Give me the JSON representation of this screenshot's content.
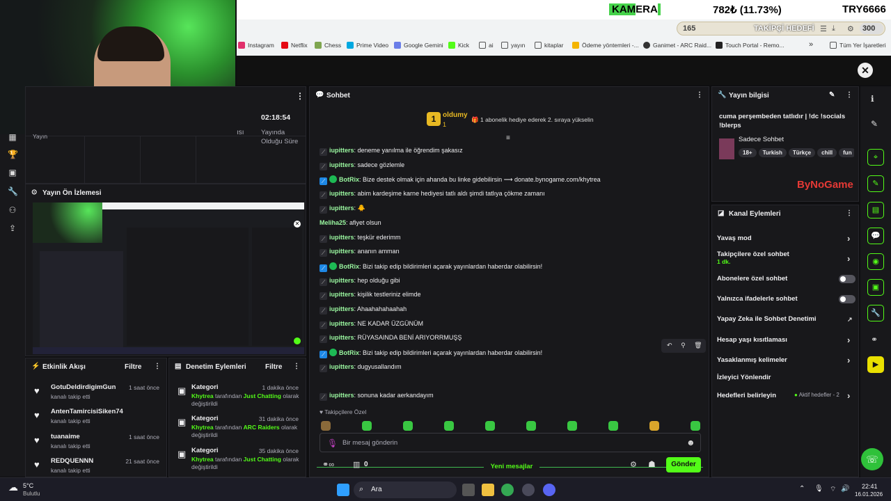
{
  "ticker": {
    "name": "KAMERA",
    "name_part1": "KAM",
    "name_part2": "ERA",
    "price": "782₺ (11.73%)",
    "pair": "TRY6666"
  },
  "browser": {
    "goal_count": "165",
    "goal_label": "TAKİPÇİ HEDEFİ",
    "points": "300",
    "bookmarks": [
      "Instagram",
      "Netflix",
      "Chess",
      "Prime Video",
      "Google Gemini",
      "Kick",
      "ai",
      "yayın",
      "kitaplar",
      "Ödeme yöntemleri -...",
      "Ganimet - ARC Raid...",
      "Touch Portal - Remo..."
    ],
    "more": "»",
    "all_bookmarks": "Tüm Yer İşaretleri"
  },
  "stats": {
    "duration": "02:18:54",
    "duration_label_1": "Yayında",
    "duration_label_2": "Olduğu Süre",
    "cut_label": "Yayın",
    "cut_label2": "ısı"
  },
  "preview": {
    "title": "Yayın Ön İzlemesi"
  },
  "activity": {
    "title": "Etkinlik Akışı",
    "filter": "Filtre",
    "items": [
      {
        "name": "GotuDeldirdigimGun",
        "sub": "kanalı takip etti",
        "time": "1 saat önce"
      },
      {
        "name": "AntenTamircisiSiken74",
        "sub": "kanalı takip etti",
        "time": "1 saat önce"
      },
      {
        "name": "tuanaime",
        "sub": "kanalı takip etti",
        "time": "1 saat önce"
      },
      {
        "name": "REDQUENNN",
        "sub": "kanalı takip etti",
        "time": "21 saat önce"
      }
    ]
  },
  "moderation": {
    "title": "Denetim Eylemleri",
    "filter": "Filtre",
    "items": [
      {
        "name": "Kategori",
        "time": "1 dakika önce",
        "who": "Khytrea",
        "mid": " tarafından ",
        "what": "Just Chatting",
        "end": " olarak",
        "end2": "değiştirildi"
      },
      {
        "name": "Kategori",
        "time": "31 dakika önce",
        "who": "Khytrea",
        "mid": " tarafından ",
        "what": "ARC Raiders",
        "end": " olarak",
        "end2": "değiştirildi"
      },
      {
        "name": "Kategori",
        "time": "35 dakika önce",
        "who": "Khytrea",
        "mid": " tarafından ",
        "what": "Just Chatting",
        "end": " olarak",
        "end2": "değiştirildi"
      }
    ]
  },
  "chat": {
    "title": "Sohbet",
    "gifter": {
      "name": "oldumy",
      "rank": "1",
      "count": "1",
      "text": "1 abonelik hediye ederek 2. sıraya yükselin"
    },
    "messages": [
      {
        "user": "iupitters",
        "text": " deneme yanılma ile öğrendim şakasız"
      },
      {
        "user": "iupitters",
        "text": " sadece gözlemle"
      },
      {
        "user": "BotRix",
        "text": " Bize destek olmak için ahanda bu linke gidebilirsin ⟶ donate.bynogame.com/khytrea",
        "bot": true
      },
      {
        "user": "iupitters",
        "text": " abim kardeşime karne hediyesi tatlı aldı şimdi tatlıya çökme zamanı"
      },
      {
        "user": "iupitters",
        "text": " 🐥"
      },
      {
        "user": "Meliha25",
        "text": " afiyet olsun",
        "plain": true
      },
      {
        "user": "iupitters",
        "text": " teşkür ederimm"
      },
      {
        "user": "iupitters",
        "text": " ananın amman"
      },
      {
        "user": "BotRix",
        "text": " Bizi takip edip bildirimleri açarak yayınlardan haberdar olabilirsin!",
        "bot": true
      },
      {
        "user": "iupitters",
        "text": " hep olduğu gibi"
      },
      {
        "user": "iupitters",
        "text": " kişilik testleriniz elimde"
      },
      {
        "user": "iupitters",
        "text": " Ahaahahahaahah"
      },
      {
        "user": "iupitters",
        "text": " NE KADAR ÜZGÜNÜM"
      },
      {
        "user": "iupitters",
        "text": " RÜYASAINDA BENİ ARIYORRMUŞŞ"
      },
      {
        "user": "BotRix",
        "text": " Bizi takip edip bildirimleri açarak yayınlardan haberdar olabilirsin!",
        "bot": true
      },
      {
        "user": "iupitters",
        "text": " dugyusallandım"
      }
    ],
    "new_messages_label": "Yeni mesajlar",
    "after": {
      "user": "iupitters",
      "text": " sonuna kadar aerkandayım"
    },
    "followers_label": "Takipçilere Özel",
    "placeholder": "Bir mesaj gönderin",
    "count": "0",
    "send": "Gönder"
  },
  "stream_info": {
    "title": "Yayın bilgisi",
    "stream_title": "cuma perşembeden tatlıdır | !dc !socials !blerps",
    "category": "Sadece Sohbet",
    "tags": [
      "18+",
      "Turkish",
      "Türkçe",
      "chill",
      "fun"
    ],
    "sponsor": "ByNoGame"
  },
  "channel": {
    "title": "Kanal Eylemleri",
    "items": [
      {
        "label": "Yavaş mod",
        "kind": "arrow"
      },
      {
        "label": "Takipçilere özel sohbet",
        "sub": "1 dk.",
        "kind": "arrow"
      },
      {
        "label": "Abonelere özel sohbet",
        "kind": "toggle"
      },
      {
        "label": "Yalnızca ifadelerle sohbet",
        "kind": "toggle"
      },
      {
        "label": "Yapay Zeka ile Sohbet Denetimi",
        "kind": "ext"
      },
      {
        "label": "Hesap yaşı kısıtlaması",
        "kind": "arrow"
      },
      {
        "label": "Yasaklanmış kelimeler",
        "kind": "arrow"
      },
      {
        "label": "İzleyici Yönlendir",
        "kind": "none"
      },
      {
        "label": "Hedefleri belirleyin",
        "kind": "arrow",
        "status": "Aktif hedefler - 2"
      }
    ]
  },
  "taskbar": {
    "temp": "5°C",
    "weather": "Bulutlu",
    "search": "Ara",
    "time": "22:41",
    "date": "16.01.2026"
  }
}
